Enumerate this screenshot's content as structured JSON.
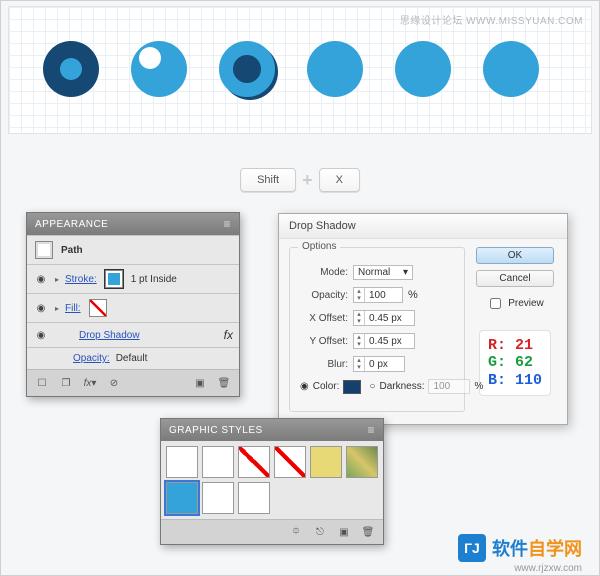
{
  "watermark_top": "思缘设计论坛  WWW.MISSYUAN.COM",
  "keys": {
    "shift": "Shift",
    "plus": "+",
    "x": "X"
  },
  "appearance": {
    "title": "APPEARANCE",
    "path_label": "Path",
    "stroke_label": "Stroke:",
    "stroke_value": "1 pt  Inside",
    "fill_label": "Fill:",
    "drop_shadow": "Drop Shadow",
    "opacity_label": "Opacity:",
    "opacity_value": "Default",
    "fx": "fx"
  },
  "dialog": {
    "title": "Drop Shadow",
    "legend": "Options",
    "mode_label": "Mode:",
    "mode_value": "Normal",
    "opacity_label": "Opacity:",
    "opacity_value": "100",
    "percent": "%",
    "xoffset_label": "X Offset:",
    "xoffset_value": "0.45 px",
    "yoffset_label": "Y Offset:",
    "yoffset_value": "0.45 px",
    "blur_label": "Blur:",
    "blur_value": "0 px",
    "color_label": "Color:",
    "darkness_label": "Darkness:",
    "darkness_value": "100",
    "ok": "OK",
    "cancel": "Cancel",
    "preview": "Preview",
    "rgb": {
      "r_label": "R:",
      "r": "21",
      "g_label": "G:",
      "g": "62",
      "b_label": "B:",
      "b": "110"
    }
  },
  "graphic_styles": {
    "title": "GRAPHIC STYLES"
  },
  "brand": {
    "cn": "软件自学网",
    "url": "www.rjzxw.com"
  }
}
